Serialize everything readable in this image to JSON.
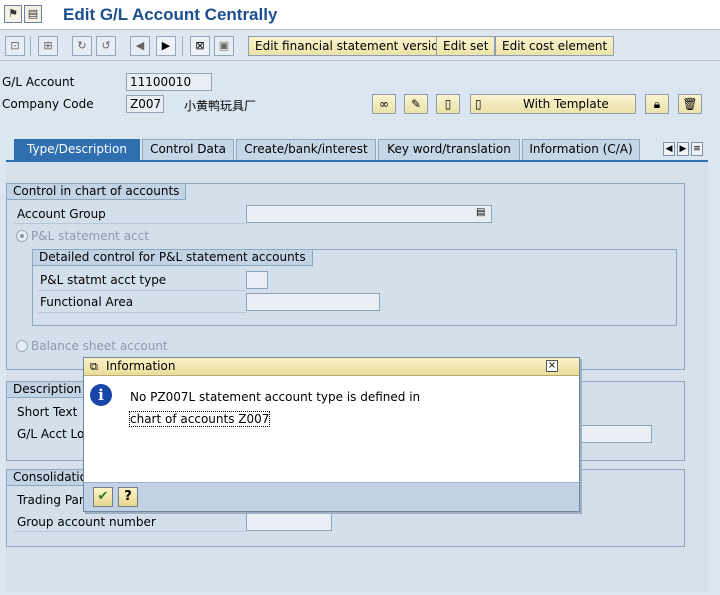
{
  "window": {
    "title": "Edit G/L Account Centrally"
  },
  "toolbar": {
    "edit_fs_version": "Edit financial statement version",
    "edit_set": "Edit set",
    "edit_cost_element": "Edit cost element"
  },
  "header": {
    "gl_account_label": "G/L Account",
    "gl_account_value": "11100010",
    "company_code_label": "Company Code",
    "company_code_value": "Z007",
    "company_name": "小黄鸭玩具厂",
    "with_template": "With Template"
  },
  "tabs": [
    "Type/Description",
    "Control Data",
    "Create/bank/interest",
    "Key word/translation",
    "Information (C/A)"
  ],
  "control_group": {
    "title": "Control in chart of accounts",
    "account_group_label": "Account Group",
    "account_group_value": "",
    "pl_radio": "P&L statement acct",
    "detail_title": "Detailed control for P&L statement accounts",
    "pl_type_label": "P&L statmt acct type",
    "functional_area_label": "Functional Area",
    "balance_radio": "Balance sheet account"
  },
  "description_group": {
    "title_partial": "Description in",
    "short_text_label": "Short Text",
    "long_text_label_partial": "G/L Acct Lo"
  },
  "consolidation_group": {
    "title_partial": "Consolidation",
    "trading_partner_label_partial": "Trading Part",
    "group_account_label": "Group account number"
  },
  "dialog": {
    "title": "Information",
    "message_line1": "No PZ007L statement account type is defined in",
    "message_line2": "chart of accounts Z007"
  }
}
